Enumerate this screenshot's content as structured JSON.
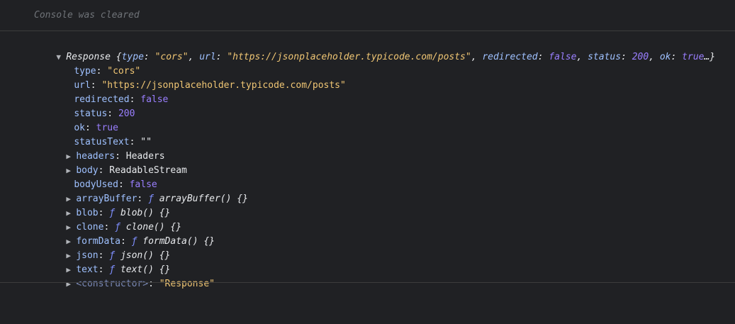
{
  "console": {
    "cleared_message": "Console was cleared",
    "summary": {
      "class_name": "Response",
      "open_brace": " {",
      "type_key": "type",
      "type_val": "\"cors\"",
      "url_key": "url",
      "url_val": "\"https://jsonplaceholder.typicode.com/posts\"",
      "redirected_key": "redirected",
      "redirected_val": "false",
      "status_key": "status",
      "status_val": "200",
      "ok_key": "ok",
      "ok_val": "true",
      "ellipsis": "…}"
    },
    "props": {
      "type_key": "type",
      "type_val": "\"cors\"",
      "url_key": "url",
      "url_val": "\"https://jsonplaceholder.typicode.com/posts\"",
      "redirected_key": "redirected",
      "redirected_val": "false",
      "status_key": "status",
      "status_val": "200",
      "ok_key": "ok",
      "ok_val": "true",
      "statusText_key": "statusText",
      "statusText_val": "\"\"",
      "headers_key": "headers",
      "headers_val": "Headers",
      "body_key": "body",
      "body_val": "ReadableStream",
      "bodyUsed_key": "bodyUsed",
      "bodyUsed_val": "false",
      "arrayBuffer_key": "arrayBuffer",
      "arrayBuffer_val": "arrayBuffer() {}",
      "blob_key": "blob",
      "blob_val": "blob() {}",
      "clone_key": "clone",
      "clone_val": "clone() {}",
      "formData_key": "formData",
      "formData_val": "formData() {}",
      "json_key": "json",
      "json_val": "json() {}",
      "text_key": "text",
      "text_val": "text() {}",
      "constructor_key": "<constructor>",
      "constructor_val": "\"Response\""
    },
    "function_keyword": "ƒ",
    "sep": ": ",
    "comma": ", ",
    "icons": {
      "expanded": "triangle-down-icon",
      "collapsed": "triangle-right-icon"
    }
  }
}
